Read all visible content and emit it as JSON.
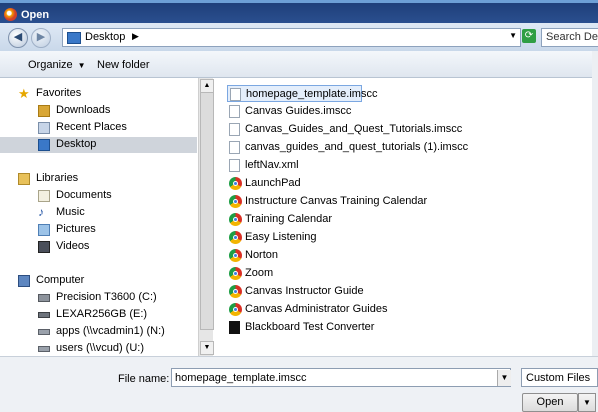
{
  "window": {
    "title": "Open"
  },
  "address": {
    "location": "Desktop",
    "separator": "▶",
    "search_placeholder": "Search Desk"
  },
  "toolbar": {
    "organize": "Organize",
    "new_folder": "New folder"
  },
  "sidebar": {
    "favorites": "Favorites",
    "downloads": "Downloads",
    "recent": "Recent Places",
    "desktop": "Desktop",
    "libraries": "Libraries",
    "documents": "Documents",
    "music": "Music",
    "pictures": "Pictures",
    "videos": "Videos",
    "computer": "Computer",
    "drive_c": "Precision T3600 (C:)",
    "drive_e": "LEXAR256GB (E:)",
    "drive_n": "apps (\\\\vcadmin1) (N:)",
    "drive_u": "users (\\\\vcud) (U:)"
  },
  "files": [
    {
      "name": "homepage_template.imscc",
      "icon": "document-icon"
    },
    {
      "name": "Canvas Guides.imscc",
      "icon": "document-icon"
    },
    {
      "name": "Canvas_Guides_and_Quest_Tutorials.imscc",
      "icon": "document-icon"
    },
    {
      "name": "canvas_guides_and_quest_tutorials (1).imscc",
      "icon": "document-icon"
    },
    {
      "name": "leftNav.xml",
      "icon": "document-icon"
    },
    {
      "name": "LaunchPad",
      "icon": "chrome-shortcut-icon"
    },
    {
      "name": "Instructure Canvas Training Calendar",
      "icon": "chrome-shortcut-icon"
    },
    {
      "name": "Training Calendar",
      "icon": "chrome-shortcut-icon"
    },
    {
      "name": "Easy Listening",
      "icon": "chrome-shortcut-icon"
    },
    {
      "name": "Norton",
      "icon": "chrome-shortcut-icon"
    },
    {
      "name": "Zoom",
      "icon": "chrome-shortcut-icon"
    },
    {
      "name": "Canvas Instructor Guide",
      "icon": "chrome-shortcut-icon"
    },
    {
      "name": "Canvas Administrator Guides",
      "icon": "chrome-shortcut-icon"
    },
    {
      "name": "Blackboard Test Converter",
      "icon": "blackboard-app-icon"
    }
  ],
  "bottom": {
    "file_name_label": "File name:",
    "file_name_value": "homepage_template.imscc",
    "file_type_value": "Custom Files",
    "open_label": "Open"
  }
}
